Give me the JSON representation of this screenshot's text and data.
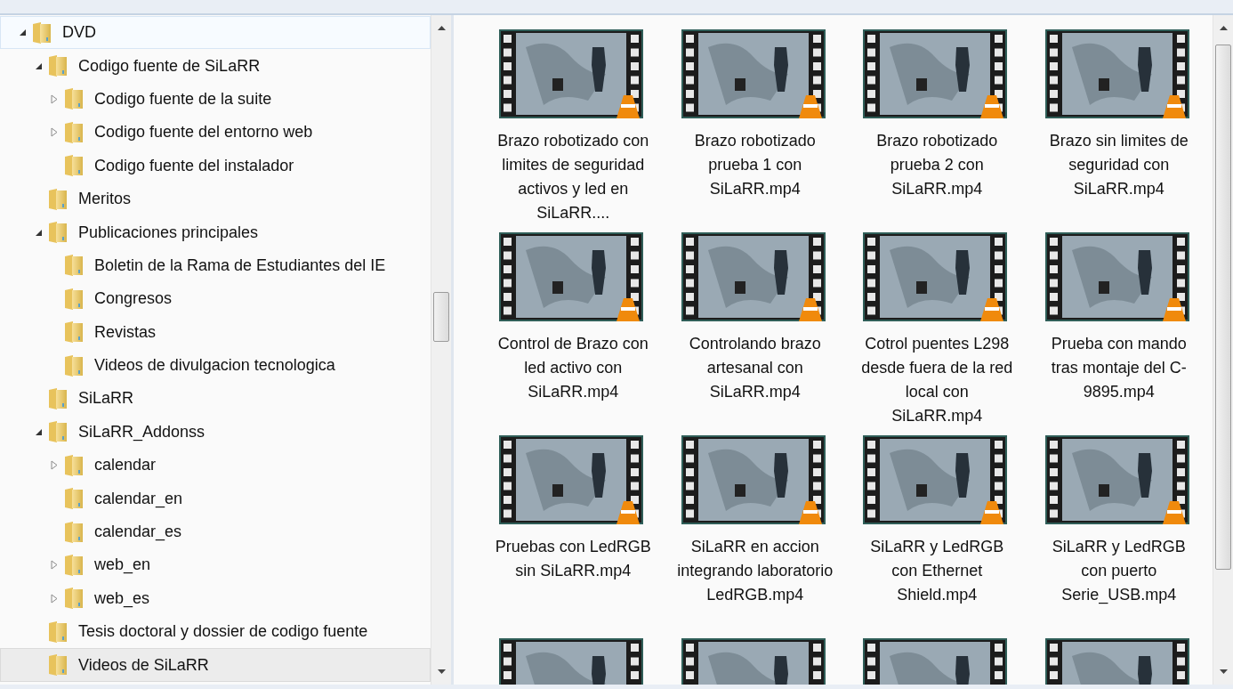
{
  "tree": [
    {
      "label": "DVD",
      "kind": "expanded",
      "selected": false,
      "hovered": true,
      "children": [
        {
          "label": "Codigo fuente de SiLaRR",
          "kind": "expanded",
          "selected": false,
          "hovered": false,
          "children": [
            {
              "label": "Codigo fuente de la suite",
              "kind": "collapsed",
              "selected": false,
              "hovered": false
            },
            {
              "label": "Codigo fuente del entorno web",
              "kind": "collapsed",
              "selected": false,
              "hovered": false
            },
            {
              "label": "Codigo fuente del instalador",
              "kind": "leaf",
              "selected": false,
              "hovered": false
            }
          ]
        },
        {
          "label": "Meritos",
          "kind": "leaf",
          "selected": false,
          "hovered": false
        },
        {
          "label": "Publicaciones principales",
          "kind": "expanded",
          "selected": false,
          "hovered": false,
          "children": [
            {
              "label": "Boletin de la Rama de Estudiantes del IE",
              "kind": "leaf",
              "selected": false,
              "hovered": false
            },
            {
              "label": "Congresos",
              "kind": "leaf",
              "selected": false,
              "hovered": false
            },
            {
              "label": "Revistas",
              "kind": "leaf",
              "selected": false,
              "hovered": false
            },
            {
              "label": "Videos de divulgacion tecnologica",
              "kind": "leaf",
              "selected": false,
              "hovered": false
            }
          ]
        },
        {
          "label": "SiLaRR",
          "kind": "leaf",
          "selected": false,
          "hovered": false
        },
        {
          "label": "SiLaRR_Addonss",
          "kind": "expanded",
          "selected": false,
          "hovered": false,
          "children": [
            {
              "label": "calendar",
              "kind": "collapsed",
              "selected": false,
              "hovered": false
            },
            {
              "label": "calendar_en",
              "kind": "leaf",
              "selected": false,
              "hovered": false
            },
            {
              "label": "calendar_es",
              "kind": "leaf",
              "selected": false,
              "hovered": false
            },
            {
              "label": "web_en",
              "kind": "collapsed",
              "selected": false,
              "hovered": false
            },
            {
              "label": "web_es",
              "kind": "collapsed",
              "selected": false,
              "hovered": false
            }
          ]
        },
        {
          "label": "Tesis doctoral y dossier de codigo fuente",
          "kind": "leaf",
          "selected": false,
          "hovered": false
        },
        {
          "label": "Videos de SiLaRR",
          "kind": "leaf",
          "selected": true,
          "hovered": false
        }
      ]
    }
  ],
  "files": [
    {
      "kind": "video",
      "name": "Brazo robotizado con limites de seguridad activos y led en SiLaRR...."
    },
    {
      "kind": "video",
      "name": "Brazo robotizado prueba 1 con SiLaRR.mp4"
    },
    {
      "kind": "video",
      "name": "Brazo robotizado prueba 2 con SiLaRR.mp4"
    },
    {
      "kind": "video",
      "name": "Brazo sin limites de seguridad con SiLaRR.mp4"
    },
    {
      "kind": "video",
      "name": "Control de Brazo con led activo con SiLaRR.mp4"
    },
    {
      "kind": "video",
      "name": "Controlando brazo artesanal con SiLaRR.mp4"
    },
    {
      "kind": "video",
      "name": "Cotrol puentes L298 desde fuera de la red local con SiLaRR.mp4"
    },
    {
      "kind": "video",
      "name": "Prueba con mando tras montaje del C-9895.mp4"
    },
    {
      "kind": "video",
      "name": "Pruebas con LedRGB sin SiLaRR.mp4"
    },
    {
      "kind": "video",
      "name": "SiLaRR en accion integrando laboratorio LedRGB.mp4"
    },
    {
      "kind": "video",
      "name": "SiLaRR y LedRGB con Ethernet Shield.mp4"
    },
    {
      "kind": "video",
      "name": "SiLaRR y LedRGB con puerto Serie_USB.mp4"
    },
    {
      "kind": "video"
    },
    {
      "kind": "video"
    },
    {
      "kind": "video"
    },
    {
      "kind": "video"
    }
  ]
}
